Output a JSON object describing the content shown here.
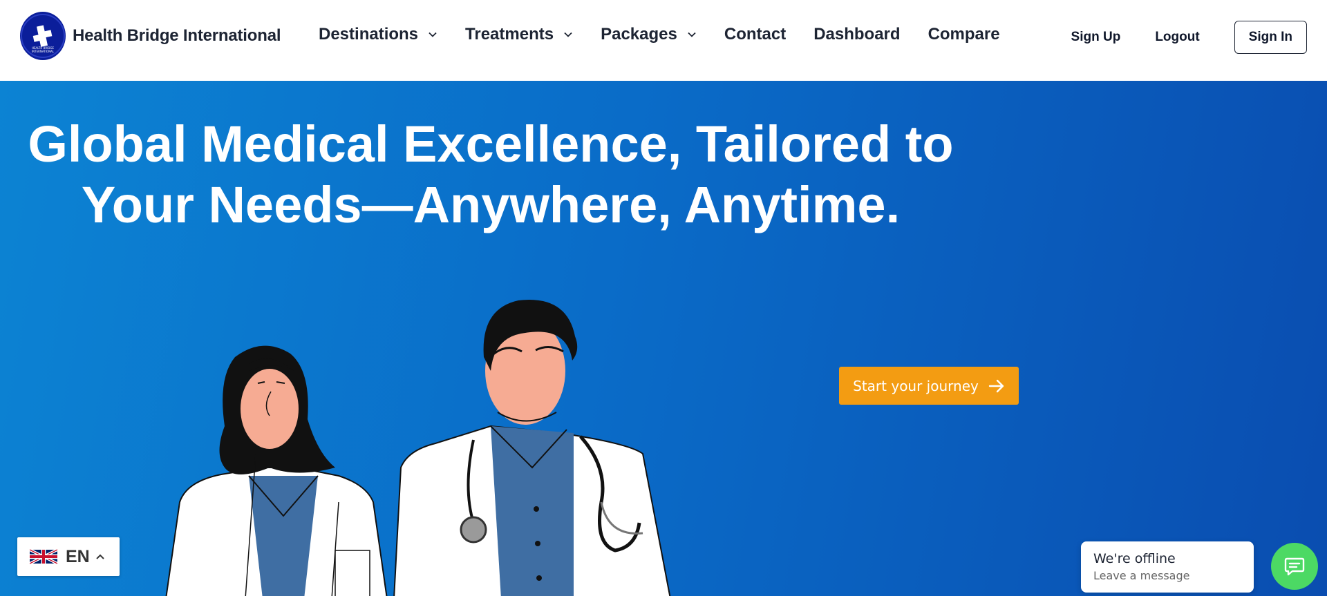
{
  "brand": {
    "name": "Health Bridge International",
    "logo_text_top": "HEALTH GATEWAY",
    "logo_text_bottom": "HEALTH BRIDGE INTERNATIONAL"
  },
  "nav": {
    "destinations": "Destinations",
    "treatments": "Treatments",
    "packages": "Packages",
    "contact": "Contact",
    "dashboard": "Dashboard",
    "compare": "Compare"
  },
  "auth": {
    "sign_up": "Sign Up",
    "logout": "Logout",
    "sign_in": "Sign In"
  },
  "hero": {
    "title_line1": "Global Medical Excellence, Tailored to",
    "title_line2": "Your Needs—Anywhere, Anytime.",
    "cta_label": "Start your journey"
  },
  "language": {
    "code": "EN"
  },
  "chat": {
    "title": "We're offline",
    "subtitle": "Leave a message"
  },
  "colors": {
    "accent": "#f39c12",
    "hero_start": "#0c83d3",
    "hero_end": "#0a4db0",
    "chat_green": "#4cd964",
    "logo_navy": "#0b1e9a"
  },
  "icons": {
    "logo": "cross-logo-icon",
    "dropdown": "chevron-down-icon",
    "cta": "arrow-right-icon",
    "lang_flag": "uk-flag-icon",
    "lang_toggle": "chevron-up-icon",
    "chat": "chat-bubble-icon"
  }
}
